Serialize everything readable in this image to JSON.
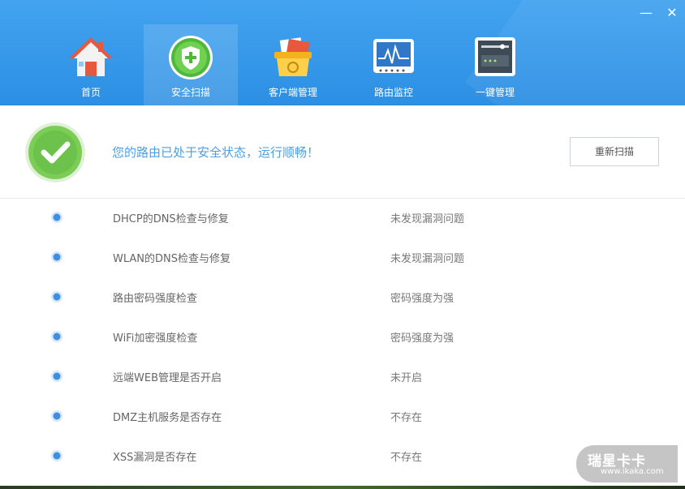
{
  "window": {
    "minimize_glyph": "—",
    "close_glyph": "✕"
  },
  "tabs": [
    {
      "label": "首页",
      "icon": "home-icon",
      "active": false
    },
    {
      "label": "安全扫描",
      "icon": "shield-plus-icon",
      "active": true
    },
    {
      "label": "客户端管理",
      "icon": "client-box-icon",
      "active": false
    },
    {
      "label": "路由监控",
      "icon": "monitor-icon",
      "active": false
    },
    {
      "label": "一键管理",
      "icon": "router-device-icon",
      "active": false
    }
  ],
  "status": {
    "message": "您的路由已处于安全状态，运行顺畅！",
    "rescan_label": "重新扫描",
    "icon": "shield-check-icon"
  },
  "checks": [
    {
      "name": "DHCP的DNS检查与修复",
      "result": "未发现漏洞问题"
    },
    {
      "name": "WLAN的DNS检查与修复",
      "result": "未发现漏洞问题"
    },
    {
      "name": "路由密码强度检查",
      "result": "密码强度为强"
    },
    {
      "name": "WiFi加密强度检查",
      "result": "密码强度为强"
    },
    {
      "name": "远端WEB管理是否开启",
      "result": "未开启"
    },
    {
      "name": "DMZ主机服务是否存在",
      "result": "不存在"
    },
    {
      "name": "XSS漏洞是否存在",
      "result": "不存在"
    }
  ],
  "watermark": {
    "title": "瑞星卡卡",
    "url": "www.ikaka.com"
  },
  "colors": {
    "header": "#3a9bec",
    "accent": "#4a9fe6",
    "ok_green": "#6cc24a"
  }
}
